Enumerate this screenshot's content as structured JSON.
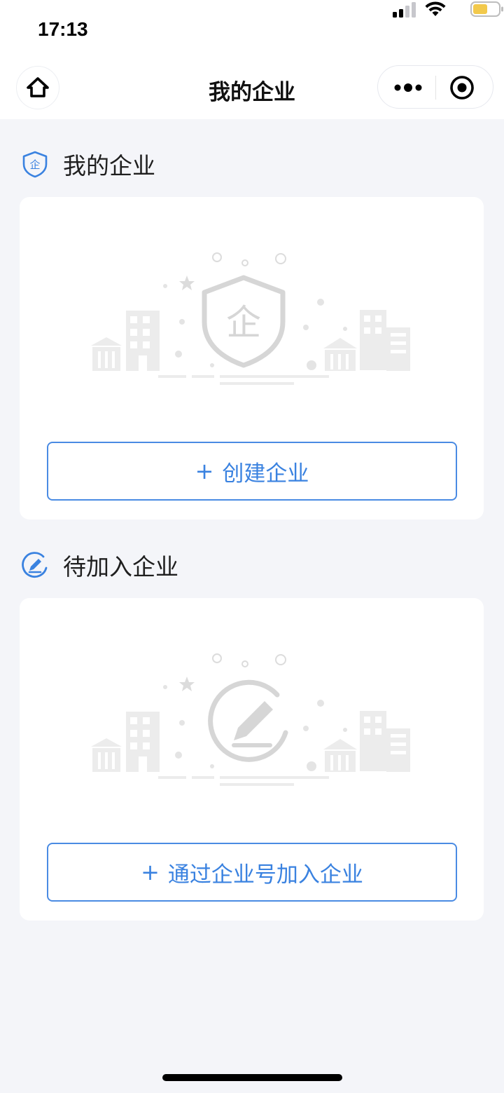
{
  "status_bar": {
    "time": "17:13"
  },
  "nav": {
    "title": "我的企业",
    "home_icon": "home-icon",
    "more_icon": "more-dots-icon",
    "close_icon": "target-close-icon"
  },
  "sections": {
    "my_companies": {
      "title": "我的企业",
      "icon": "shield-enterprise-icon",
      "icon_glyph": "企",
      "button_plus": "+",
      "button_label": "创建企业"
    },
    "pending_companies": {
      "title": "待加入企业",
      "icon": "edit-circle-icon",
      "button_plus": "+",
      "button_label": "通过企业号加入企业"
    }
  },
  "colors": {
    "accent": "#3a82e0",
    "background": "#f4f5f9",
    "battery": "#f2c94c"
  }
}
